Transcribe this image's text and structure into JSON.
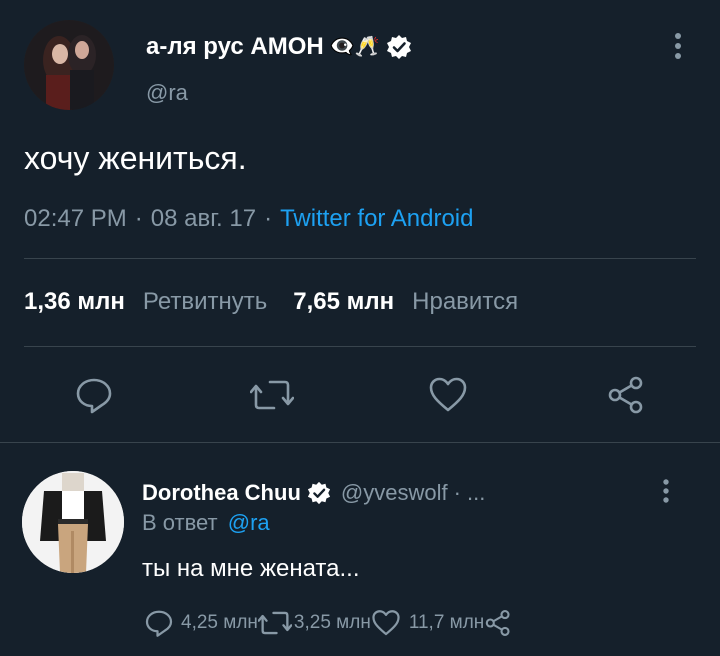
{
  "main_tweet": {
    "display_name": "а-ля рус АМОН",
    "name_emoji": "👁‍🗨🥂",
    "handle": "@ra",
    "text": "хочу жениться.",
    "time": "02:47 PM",
    "sep1": "·",
    "date": "08 авг. 17",
    "sep2": "·",
    "source": "Twitter for Android",
    "retweets_count": "1,36 млн",
    "retweets_label": "Ретвитнуть",
    "likes_count": "7,65 млн",
    "likes_label": "Нравится"
  },
  "reply": {
    "display_name": "Dorothea Chuu",
    "handle": "@yveswolf",
    "handle_suffix": "· ...",
    "reply_prefix": "В ответ",
    "reply_to": "@ra",
    "text": "ты на мне жената...",
    "replies": "4,25 млн",
    "retweets": "3,25 млн",
    "likes": "11,7 млн"
  },
  "colors": {
    "background": "#15202b",
    "text": "#ffffff",
    "muted": "#8899a6",
    "accent": "#1da1f2",
    "divider": "#38444d"
  }
}
